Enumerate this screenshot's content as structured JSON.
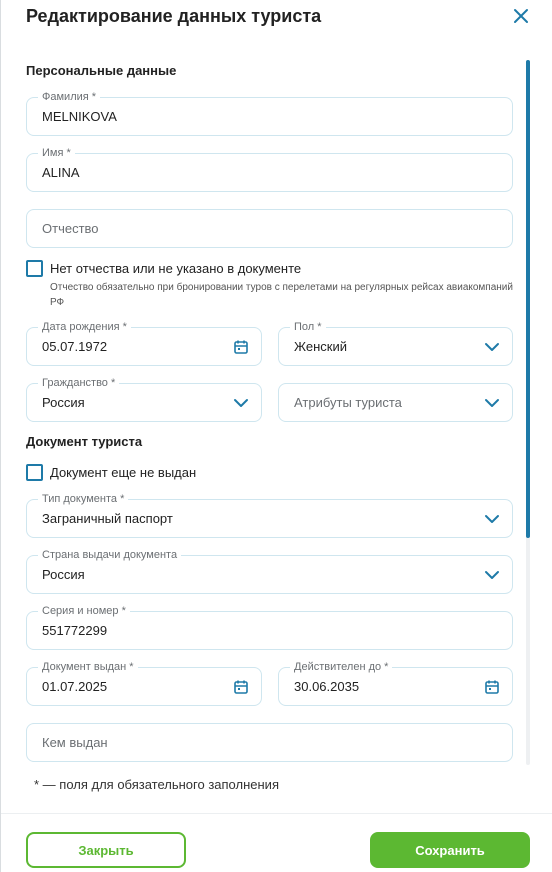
{
  "modal": {
    "title": "Редактирование данных туриста"
  },
  "personal": {
    "section_title": "Персональные данные",
    "surname": {
      "label": "Фамилия *",
      "value": "MELNIKOVA"
    },
    "name": {
      "label": "Имя *",
      "value": "ALINA"
    },
    "patronymic": {
      "placeholder": "Отчество"
    },
    "no_patronymic": {
      "label": "Нет отчества или не указано в документе",
      "hint": "Отчество обязательно при бронировании туров с перелетами на регулярных рейсах авиакомпаний РФ",
      "checked": false
    },
    "birth_date": {
      "label": "Дата рождения *",
      "value": "05.07.1972",
      "icon": "calendar-icon"
    },
    "gender": {
      "label": "Пол *",
      "value": "Женский",
      "icon": "chevron-down-icon"
    },
    "citizenship": {
      "label": "Гражданство *",
      "value": "Россия",
      "icon": "chevron-down-icon"
    },
    "attributes": {
      "placeholder": "Атрибуты туриста",
      "icon": "chevron-down-icon"
    }
  },
  "document": {
    "section_title": "Документ туриста",
    "not_issued": {
      "label": "Документ еще не выдан",
      "checked": false
    },
    "doc_type": {
      "label": "Тип документа *",
      "value": "Заграничный паспорт"
    },
    "issue_country": {
      "label": "Страна выдачи документа",
      "value": "Россия"
    },
    "series_number": {
      "label": "Серия и номер *",
      "value": "551772299"
    },
    "issued_date": {
      "label": "Документ выдан *",
      "value": "01.07.2025"
    },
    "valid_until": {
      "label": "Действителен до *",
      "value": "30.06.2035"
    },
    "issued_by": {
      "placeholder": "Кем выдан"
    }
  },
  "required_note": "* — поля для обязательного заполнения",
  "footer": {
    "close_label": "Закрыть",
    "save_label": "Сохранить"
  },
  "colors": {
    "accent": "#1e7aa8",
    "primary_button": "#5cb832",
    "field_border": "#cfe6ef"
  },
  "scroll_position_fraction": 0.0
}
